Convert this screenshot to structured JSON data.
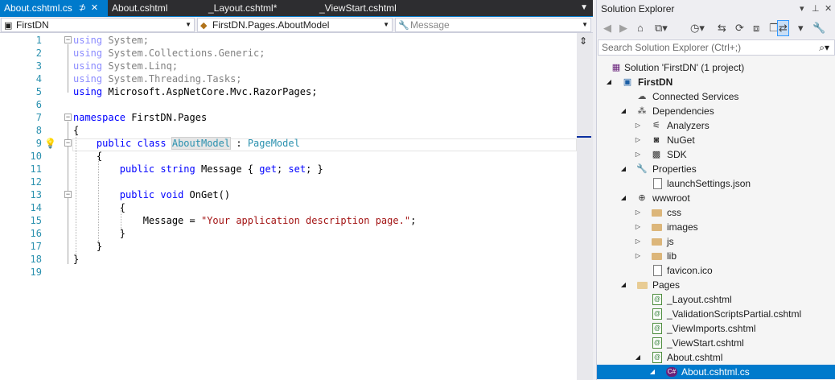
{
  "tabs": [
    {
      "label": "About.cshtml.cs",
      "pin": "⊅",
      "close": "✕",
      "active": true
    },
    {
      "label": "About.cshtml"
    },
    {
      "label": "_Layout.cshtml*"
    },
    {
      "label": "_ViewStart.cshtml"
    }
  ],
  "nav": {
    "project": "FirstDN",
    "type": "FirstDN.Pages.AboutModel",
    "member": "Message"
  },
  "code_lines": [
    {
      "n": "1"
    },
    {
      "n": "2"
    },
    {
      "n": "3"
    },
    {
      "n": "4"
    },
    {
      "n": "5"
    },
    {
      "n": "6"
    },
    {
      "n": "7"
    },
    {
      "n": "8"
    },
    {
      "n": "9"
    },
    {
      "n": "10"
    },
    {
      "n": "11"
    },
    {
      "n": "12"
    },
    {
      "n": "13"
    },
    {
      "n": "14"
    },
    {
      "n": "15"
    },
    {
      "n": "16"
    },
    {
      "n": "17"
    },
    {
      "n": "18"
    },
    {
      "n": "19"
    }
  ],
  "code": {
    "using": "using",
    "ns1": "System;",
    "ns2": "System.Collections.Generic;",
    "ns3": "System.Linq;",
    "ns4": "System.Threading.Tasks;",
    "ns5": "Microsoft.AspNetCore.Mvc.RazorPages;",
    "namespace_kw": "namespace",
    "namespace_name": "FirstDN.Pages",
    "open_brace": "{",
    "close_brace": "}",
    "public_kw": "public",
    "class_kw": "class",
    "class_name": "AboutModel",
    "colon": ":",
    "base_class": "PageModel",
    "string_kw": "string",
    "prop_name": "Message",
    "get_kw": "get",
    "set_kw": "set",
    "void_kw": "void",
    "method_name": "OnGet",
    "assign_target": "Message",
    "string_value": "\"Your application description page.\""
  },
  "solution_explorer": {
    "title": "Solution Explorer",
    "search_placeholder": "Search Solution Explorer (Ctrl+;)",
    "items": [
      {
        "label": "Solution 'FirstDN' (1 project)"
      },
      {
        "label": "FirstDN"
      },
      {
        "label": "Connected Services"
      },
      {
        "label": "Dependencies"
      },
      {
        "label": "Analyzers"
      },
      {
        "label": "NuGet"
      },
      {
        "label": "SDK"
      },
      {
        "label": "Properties"
      },
      {
        "label": "launchSettings.json"
      },
      {
        "label": "wwwroot"
      },
      {
        "label": "css"
      },
      {
        "label": "images"
      },
      {
        "label": "js"
      },
      {
        "label": "lib"
      },
      {
        "label": "favicon.ico"
      },
      {
        "label": "Pages"
      },
      {
        "label": "_Layout.cshtml"
      },
      {
        "label": "_ValidationScriptsPartial.cshtml"
      },
      {
        "label": "_ViewImports.cshtml"
      },
      {
        "label": "_ViewStart.cshtml"
      },
      {
        "label": "About.cshtml"
      },
      {
        "label": "About.cshtml.cs",
        "selected": true
      }
    ]
  },
  "colors": {
    "accent": "#007ACC",
    "keyword": "#0000FF",
    "type": "#2B91AF",
    "string": "#A31515",
    "tabbar": "#2D2D30"
  }
}
